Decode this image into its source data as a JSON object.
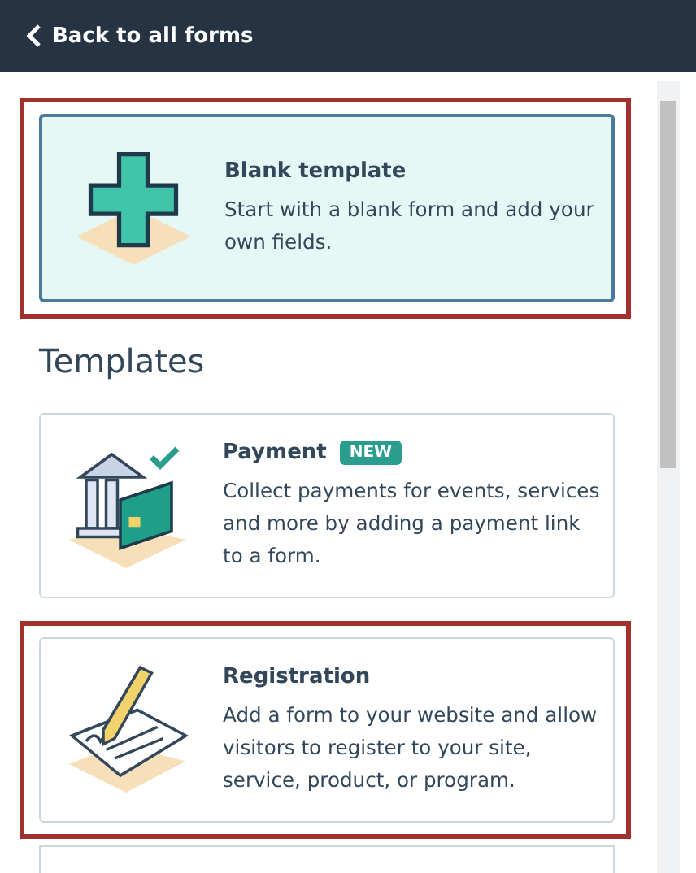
{
  "header": {
    "back_label": "Back to all forms"
  },
  "blank": {
    "title": "Blank template",
    "description": "Start with a blank form and add your own fields.",
    "selected": true,
    "highlighted": true,
    "kind": "blank"
  },
  "templates_heading": "Templates",
  "templates": [
    {
      "kind": "payment",
      "title": "Payment",
      "badge": "NEW",
      "description": "Collect payments for events, services and more by adding a payment link to a form.",
      "selected": false,
      "highlighted": false
    },
    {
      "kind": "registration",
      "title": "Registration",
      "description": "Add a form to your website and allow visitors to register to your site, service, product, or program.",
      "selected": false,
      "highlighted": true
    },
    {
      "kind": "cut-off"
    }
  ]
}
